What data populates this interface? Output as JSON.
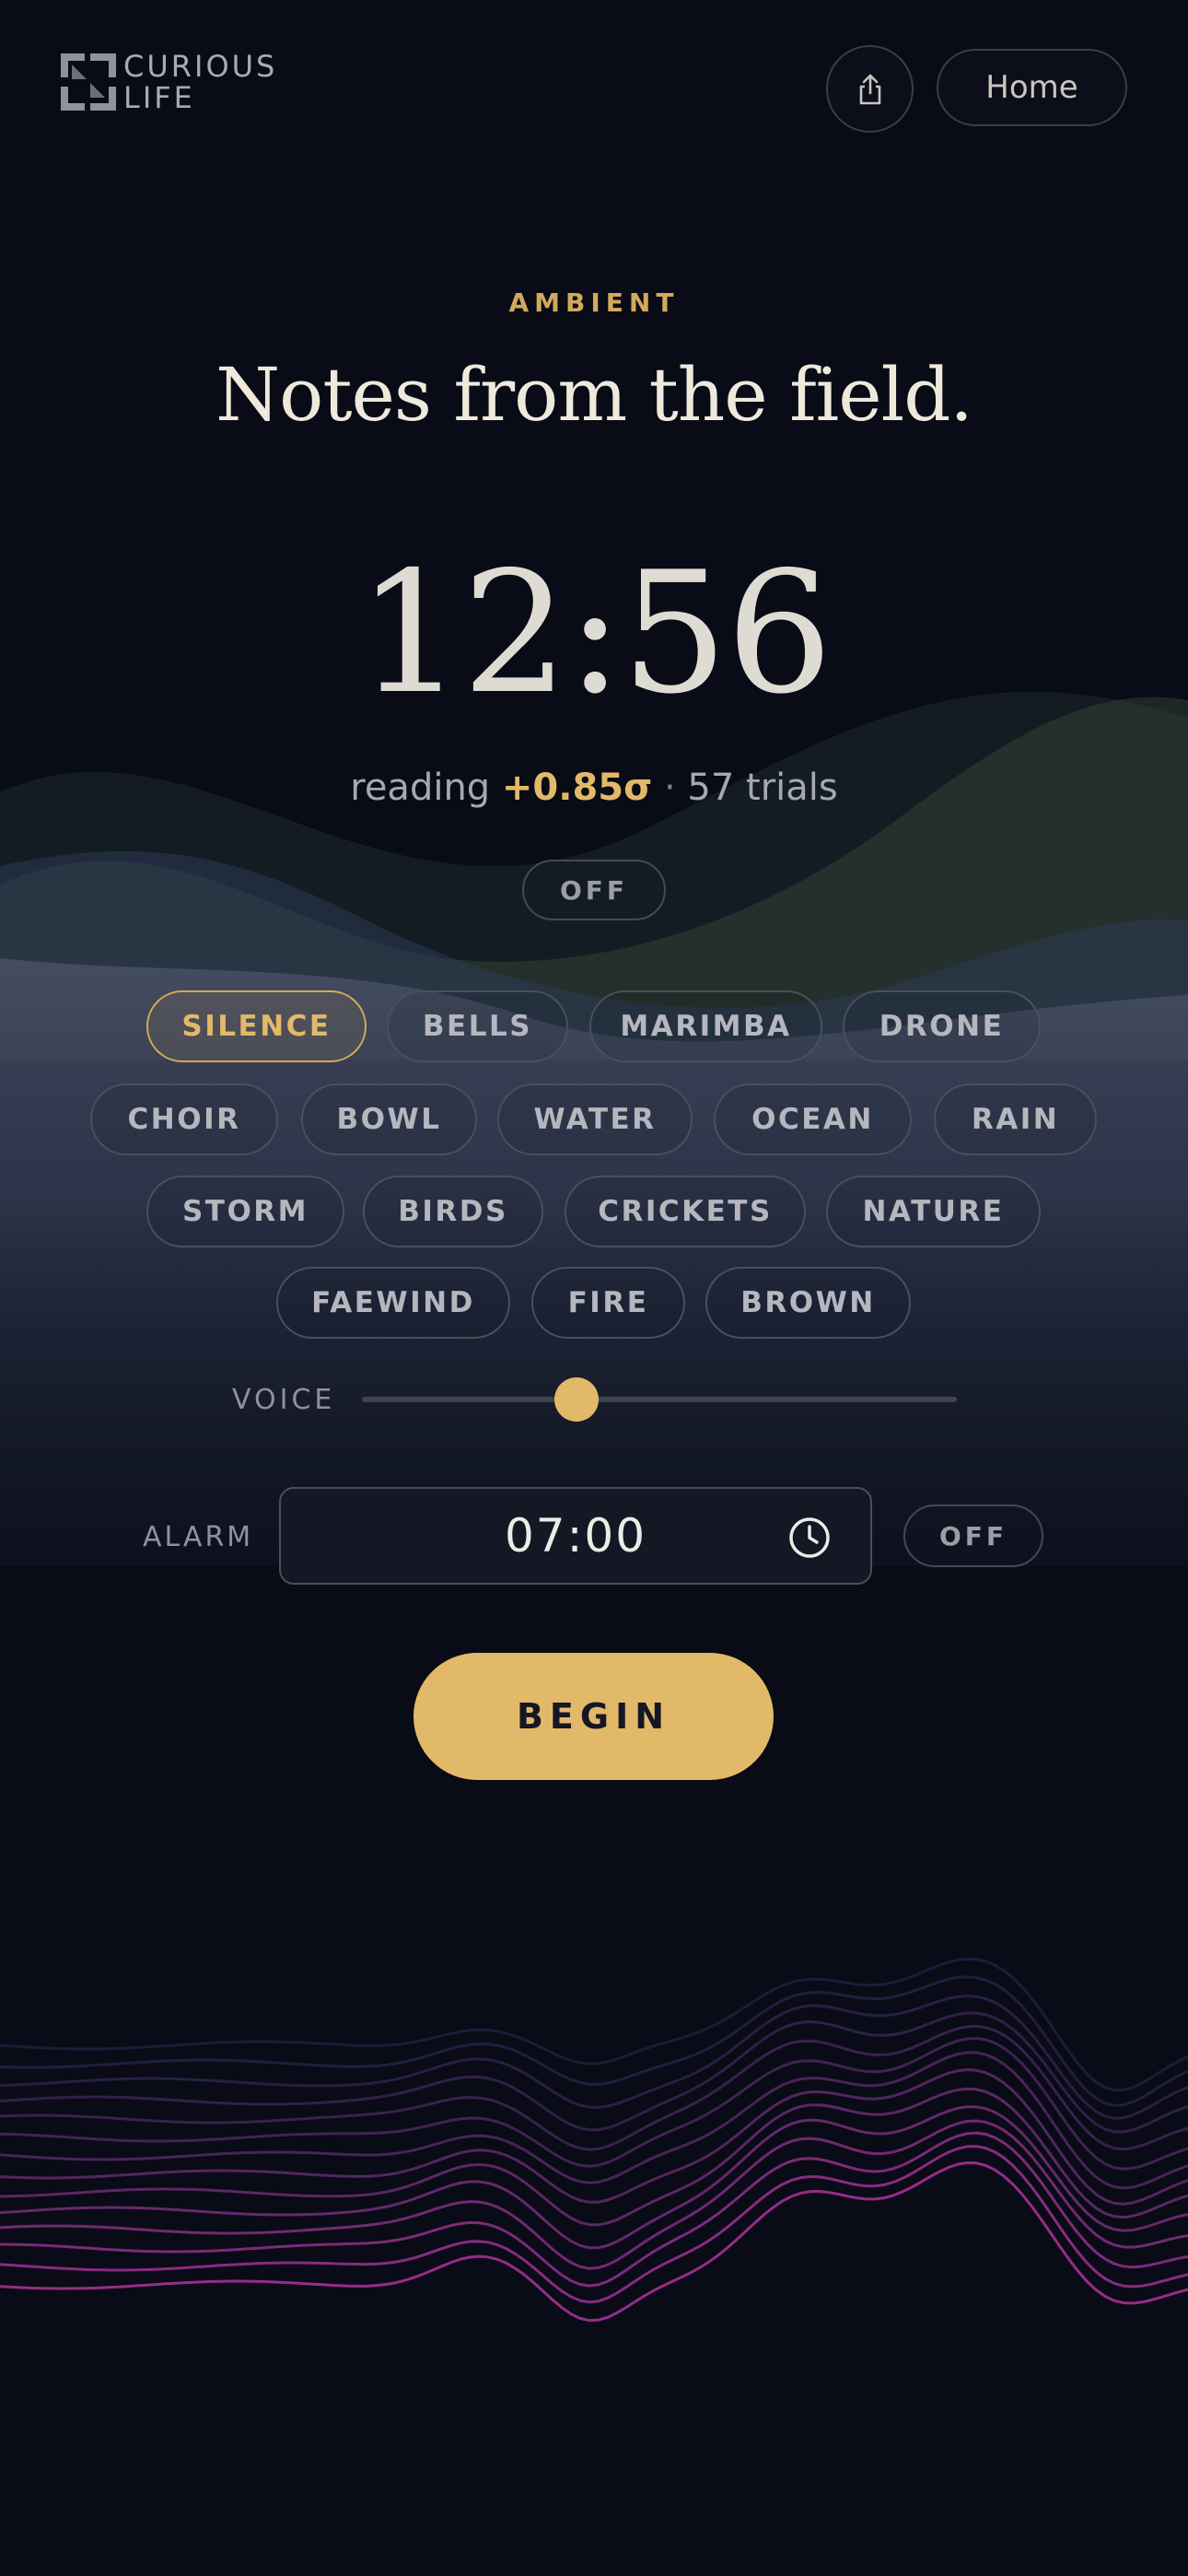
{
  "brand": {
    "line1": "CURIOUS",
    "line2": "LIFE",
    "mark_icon": "curious-life-logo"
  },
  "header": {
    "share_icon": "share-icon",
    "home_label": "Home"
  },
  "hero": {
    "eyebrow": "AMBIENT",
    "title": "Notes from the field."
  },
  "clock": {
    "time": "12:56"
  },
  "reading": {
    "prefix": "reading",
    "value": "+0.85σ",
    "separator": "·",
    "trials": "57 trials"
  },
  "field_toggle": {
    "label": "OFF"
  },
  "sounds": {
    "selected": "SILENCE",
    "items": [
      "SILENCE",
      "BELLS",
      "MARIMBA",
      "DRONE",
      "CHOIR",
      "BOWL",
      "WATER",
      "OCEAN",
      "RAIN",
      "STORM",
      "BIRDS",
      "CRICKETS",
      "NATURE",
      "FAEWIND",
      "FIRE",
      "BROWN"
    ]
  },
  "voice": {
    "label": "VOICE",
    "level": 0.36
  },
  "alarm": {
    "label": "ALARM",
    "time": "07:00",
    "toggle_label": "OFF",
    "icon": "clock-icon"
  },
  "begin": {
    "label": "BEGIN"
  },
  "colors": {
    "accent": "#e2b968",
    "background": "#090b16",
    "wave_magenta": "#b0459a"
  }
}
